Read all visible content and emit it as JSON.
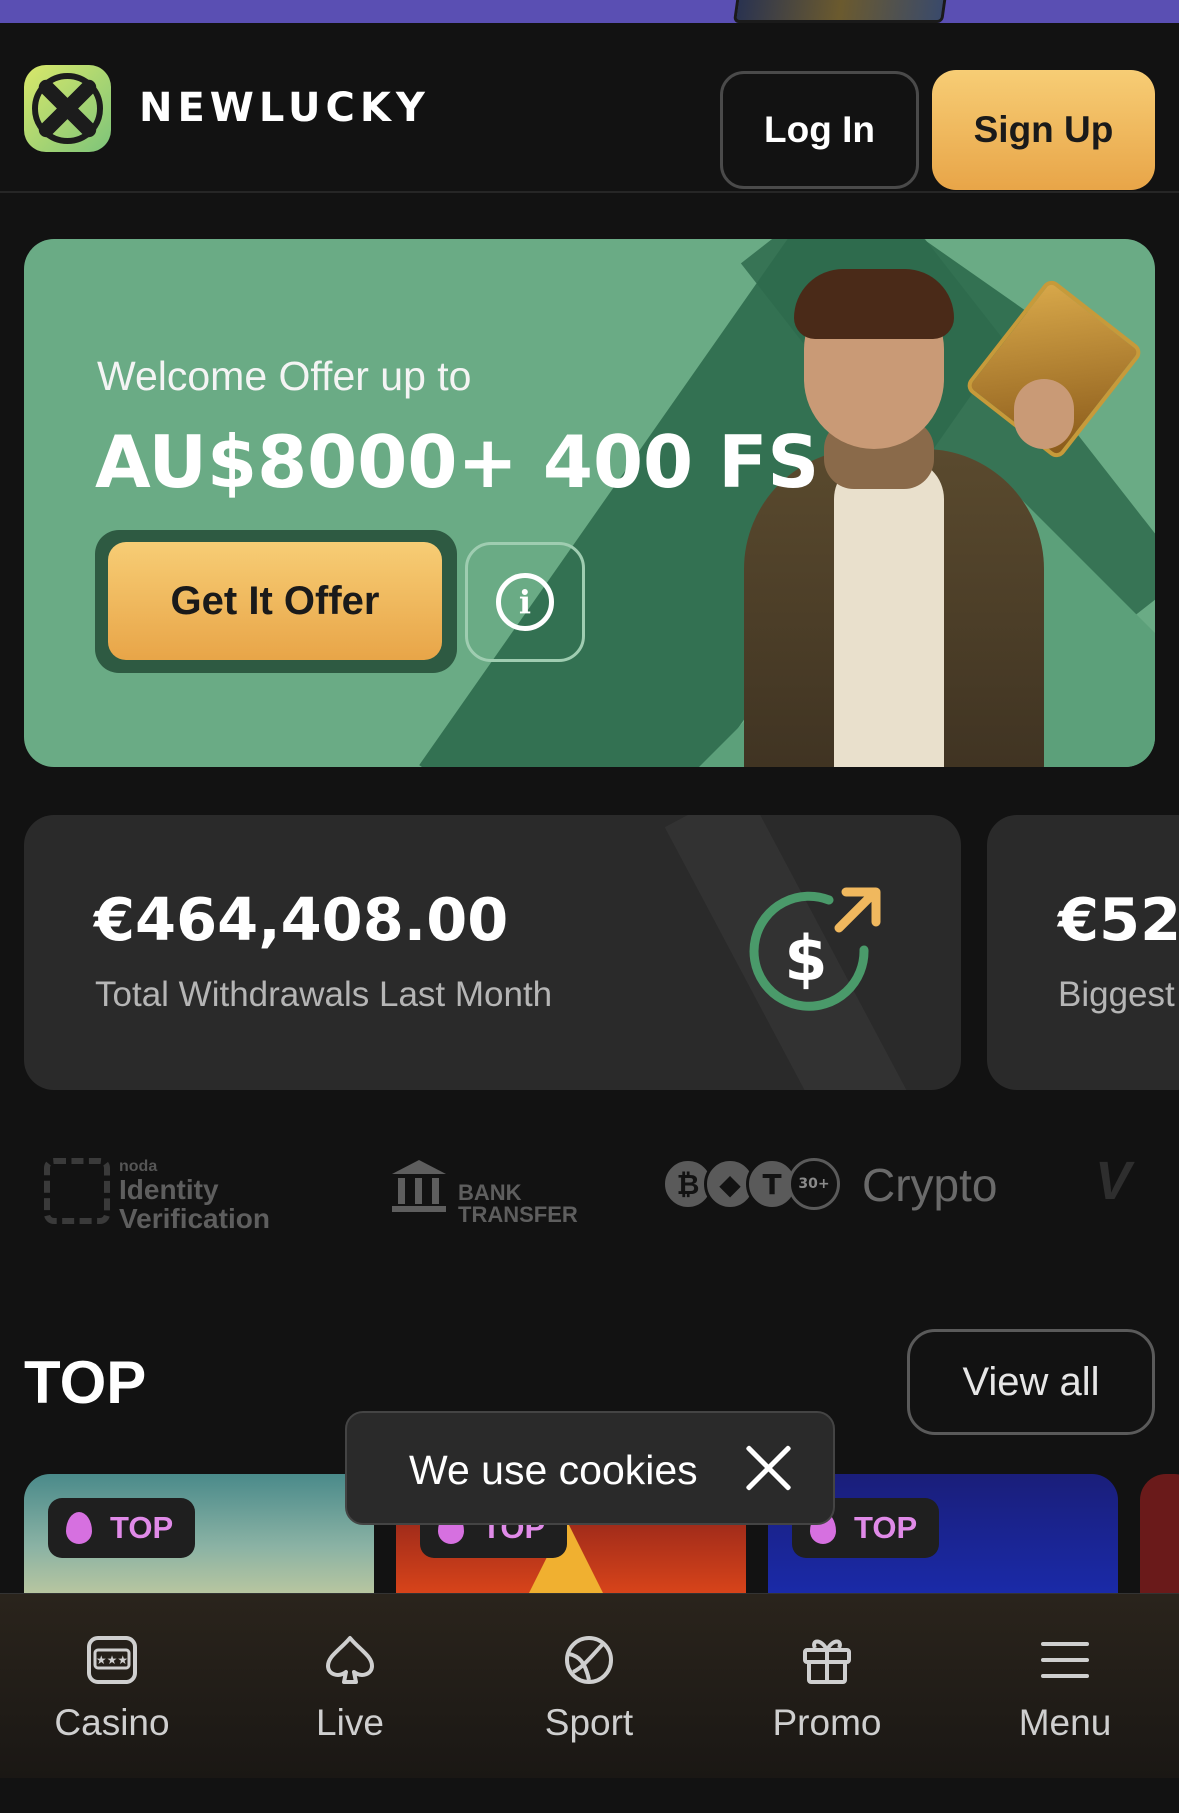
{
  "header": {
    "brand": "NEWLUCKY",
    "login_label": "Log In",
    "signup_label": "Sign Up"
  },
  "banner": {
    "welcome": "Welcome Offer up to",
    "amount": "AU$8000+ 400 FS",
    "offer_button": "Get It Offer"
  },
  "stats": [
    {
      "value": "€464,408.00",
      "label": "Total Withdrawals Last Month"
    },
    {
      "value": "€52",
      "label": "Biggest"
    }
  ],
  "payments": {
    "noda_small": "noda",
    "noda_line1": "Identity",
    "noda_line2": "Verification",
    "bank_line1": "BANK",
    "bank_line2": "TRANSFER",
    "crypto_label": "Crypto",
    "crypto_more": "30+",
    "partial_label": "V"
  },
  "top_section": {
    "title": "TOP",
    "view_all": "View all",
    "badge": "TOP"
  },
  "cookie": {
    "text": "We use cookies"
  },
  "nav": [
    {
      "label": "Casino",
      "icon": "slot-machine-icon"
    },
    {
      "label": "Live",
      "icon": "spade-icon"
    },
    {
      "label": "Sport",
      "icon": "ball-icon"
    },
    {
      "label": "Promo",
      "icon": "gift-icon"
    },
    {
      "label": "Menu",
      "icon": "hamburger-icon"
    }
  ],
  "colors": {
    "accent": "#F0B85E",
    "banner_green": "#6AAB85",
    "badge_pink": "#E08AE8",
    "top_strip": "#5A4FB3"
  }
}
